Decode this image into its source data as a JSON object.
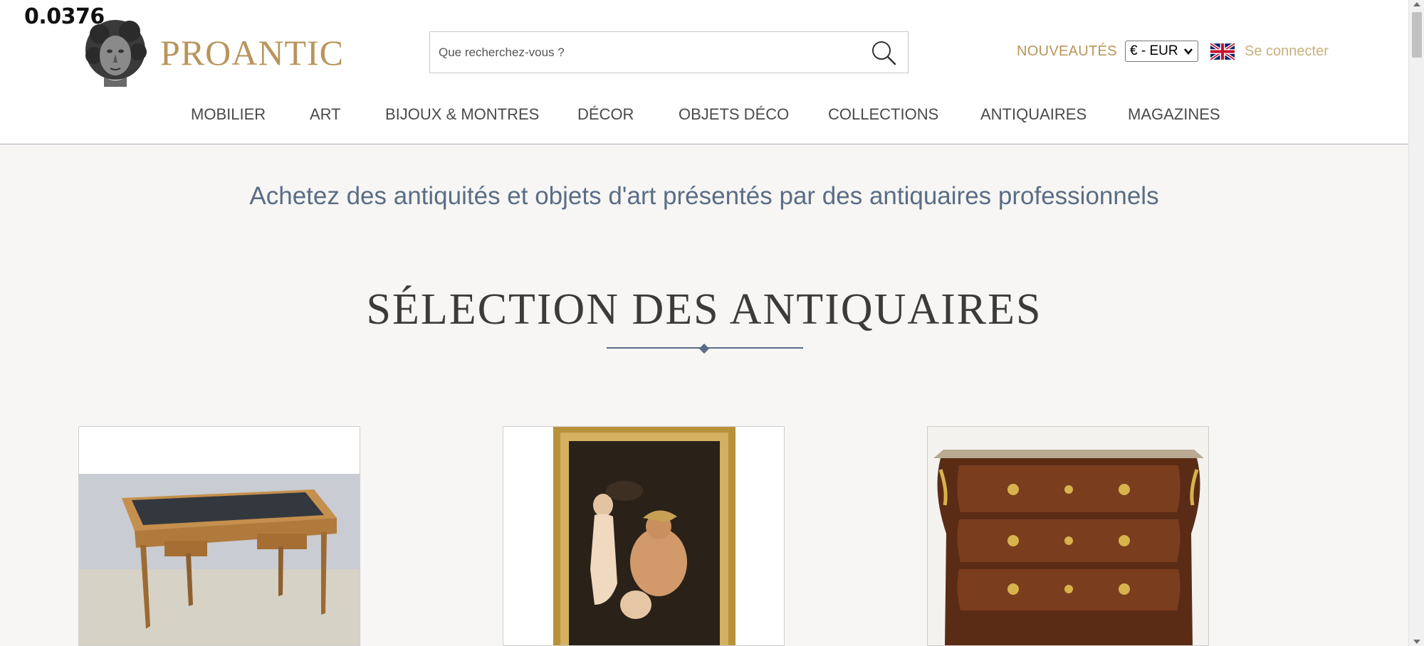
{
  "overlay_value": "0.0376",
  "header": {
    "logo_text": "PROANTIC",
    "search": {
      "placeholder": "Que recherchez-vous ?"
    },
    "nouveautes_label": "NOUVEAUTÉS",
    "currency_selected": "€ - EUR",
    "login_label": "Se connecter"
  },
  "nav": {
    "items": [
      {
        "label": "MOBILIER"
      },
      {
        "label": "ART"
      },
      {
        "label": "BIJOUX & MONTRES"
      },
      {
        "label": "DÉCOR"
      },
      {
        "label": "OBJETS DÉCO"
      },
      {
        "label": "COLLECTIONS"
      },
      {
        "label": "ANTIQUAIRES"
      },
      {
        "label": "MAGAZINES"
      }
    ]
  },
  "main": {
    "tagline": "Achetez des antiquités et objets d'art présentés par des antiquaires professionnels",
    "section_title": "SÉLECTION DES ANTIQUAIRES"
  },
  "colors": {
    "gold": "#b8955a",
    "slate_blue": "#5a6d85",
    "background": "#f7f6f4"
  }
}
